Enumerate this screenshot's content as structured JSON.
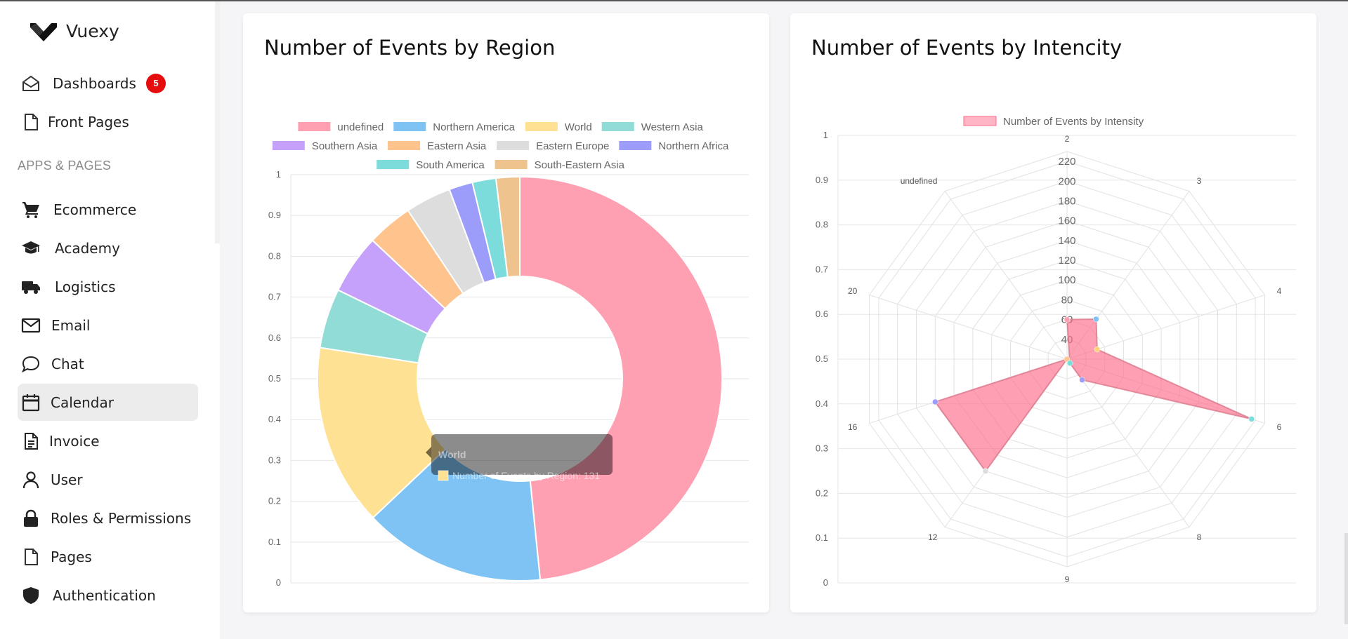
{
  "app": {
    "brand": "Vuexy"
  },
  "sidebar": {
    "section_title": "APPS & PAGES",
    "items": [
      {
        "label": "Dashboards",
        "icon": "home-icon",
        "badge": "5"
      },
      {
        "label": "Front Pages",
        "icon": "file-icon"
      },
      {
        "label": "Ecommerce",
        "icon": "cart-icon"
      },
      {
        "label": "Academy",
        "icon": "school-icon"
      },
      {
        "label": "Logistics",
        "icon": "truck-icon"
      },
      {
        "label": "Email",
        "icon": "mail-icon"
      },
      {
        "label": "Chat",
        "icon": "chat-icon"
      },
      {
        "label": "Calendar",
        "icon": "calendar-icon",
        "active": true
      },
      {
        "label": "Invoice",
        "icon": "invoice-icon"
      },
      {
        "label": "User",
        "icon": "user-icon"
      },
      {
        "label": "Roles & Permissions",
        "icon": "lock-icon"
      },
      {
        "label": "Pages",
        "icon": "file-icon"
      },
      {
        "label": "Authentication",
        "icon": "shield-icon"
      }
    ]
  },
  "cards": {
    "region_title": "Number of Events by Region",
    "intensity_title": "Number of Events by Intencity"
  },
  "chart_data": [
    {
      "type": "pie",
      "title": "Number of Events by Region",
      "variant": "doughnut",
      "categories": [
        "undefined",
        "Northern America",
        "World",
        "Western Asia",
        "Southern Asia",
        "Eastern Asia",
        "Eastern Europe",
        "Northern Africa",
        "South America",
        "South-Eastern Asia"
      ],
      "values": [
        436,
        131,
        131,
        43,
        43,
        33,
        33,
        17,
        17,
        17
      ],
      "colors": [
        "#ff9fb2",
        "#7fc3f5",
        "#ffe194",
        "#92dcd7",
        "#c5a1fb",
        "#ffc38e",
        "#dddddd",
        "#9c9cfb",
        "#7cdcdc",
        "#eec38e"
      ],
      "legend": "top",
      "y_axis_ticks": [
        "0",
        "0.1",
        "0.2",
        "0.3",
        "0.4",
        "0.5",
        "0.6",
        "0.7",
        "0.8",
        "0.9",
        "1"
      ],
      "tooltip": {
        "title": "World",
        "body": "Number of Events by Region: 131"
      }
    },
    {
      "type": "radar",
      "title": "Number of Events by Intencity",
      "categories": [
        "2",
        "3",
        "4",
        "6",
        "8",
        "9",
        "12",
        "16",
        "20",
        "undefined"
      ],
      "series": [
        {
          "name": "Number of Events by Intensity",
          "values": [
            60,
            70,
            52,
            216,
            46,
            20,
            160,
            160,
            20,
            15
          ],
          "color": "#ff6b8b"
        }
      ],
      "point_colors": [
        "#ff9fb2",
        "#7fc3f5",
        "#ffd27a",
        "#7cdcdc",
        "#9c9cfb",
        "#ffd27a",
        "#dddddd",
        "#9c9cfb",
        "#ffc38e",
        "#7cdcdc"
      ],
      "r_ticks": [
        "40",
        "60",
        "80",
        "100",
        "120",
        "140",
        "160",
        "180",
        "200",
        "220"
      ],
      "r_range": [
        20,
        230
      ],
      "y_axis_ticks": [
        "0",
        "0.1",
        "0.2",
        "0.3",
        "0.4",
        "0.5",
        "0.6",
        "0.7",
        "0.8",
        "0.9",
        "1"
      ],
      "legend": "top"
    }
  ]
}
